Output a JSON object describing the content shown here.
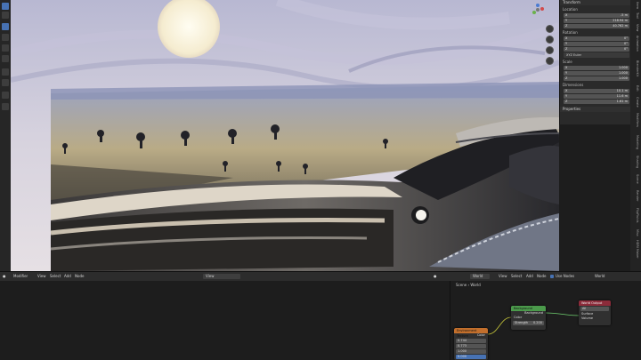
{
  "app": {
    "accent": "#4772b3"
  },
  "toolbar": {
    "tools": [
      "select-tool-icon",
      "cursor-icon",
      "move-icon",
      "rotate-icon",
      "scale-icon",
      "transform-icon",
      "annotate-icon",
      "measure-icon",
      "add-cube-icon",
      "camera-icon"
    ]
  },
  "npanel": {
    "transform_title": "Transform",
    "location_label": "Location",
    "location": [
      {
        "axis": "X",
        "value": "-5 m"
      },
      {
        "axis": "Y",
        "value": "218.94 m"
      },
      {
        "axis": "Z",
        "value": "40.762 m"
      }
    ],
    "rotation_label": "Rotation",
    "rotation": [
      {
        "axis": "X",
        "value": "0°"
      },
      {
        "axis": "Y",
        "value": "0°"
      },
      {
        "axis": "Z",
        "value": "0°"
      }
    ],
    "rotation_mode": "XYZ Euler",
    "scale_label": "Scale",
    "scale": [
      {
        "axis": "X",
        "value": "1.000"
      },
      {
        "axis": "Y",
        "value": "1.000"
      },
      {
        "axis": "Z",
        "value": "1.000"
      }
    ],
    "dimensions_label": "Dimensions",
    "dimensions": [
      {
        "axis": "X",
        "value": "10.1 m"
      },
      {
        "axis": "Y",
        "value": "11.6 m"
      },
      {
        "axis": "Z",
        "value": "1.61 m"
      }
    ],
    "properties_title": "Properties",
    "tabs": [
      "Item",
      "Tool",
      "View",
      "Animation",
      "BlenderKit",
      "Edit",
      "Create",
      "Modifiers",
      "Modeling",
      "Shading",
      "Scene",
      "Render",
      "FlipFluids",
      "Misc",
      "HDRI Maker"
    ]
  },
  "footer": {
    "left_editor": "Modifier",
    "left_menus": [
      "View",
      "Select",
      "Add",
      "Node"
    ],
    "left_mode": "View",
    "right_editor": "World",
    "right_menus": [
      "View",
      "Select",
      "Add",
      "Node"
    ],
    "use_nodes_label": "Use Nodes",
    "world_name": "World",
    "breadcrumb_scene": "Scene",
    "breadcrumb_world": "World"
  },
  "nodes": {
    "background": {
      "title": "Background",
      "output": "Background",
      "color_label": "Color",
      "strength_label": "Strength",
      "strength_value": "0.200"
    },
    "world_output": {
      "title": "World Output",
      "target": "All",
      "surface": "Surface",
      "volume": "Volume"
    },
    "texture": {
      "title": "Environment Texture",
      "rows": [
        "Color",
        "0.744",
        "0.773",
        "1.000",
        "0.000"
      ]
    }
  }
}
